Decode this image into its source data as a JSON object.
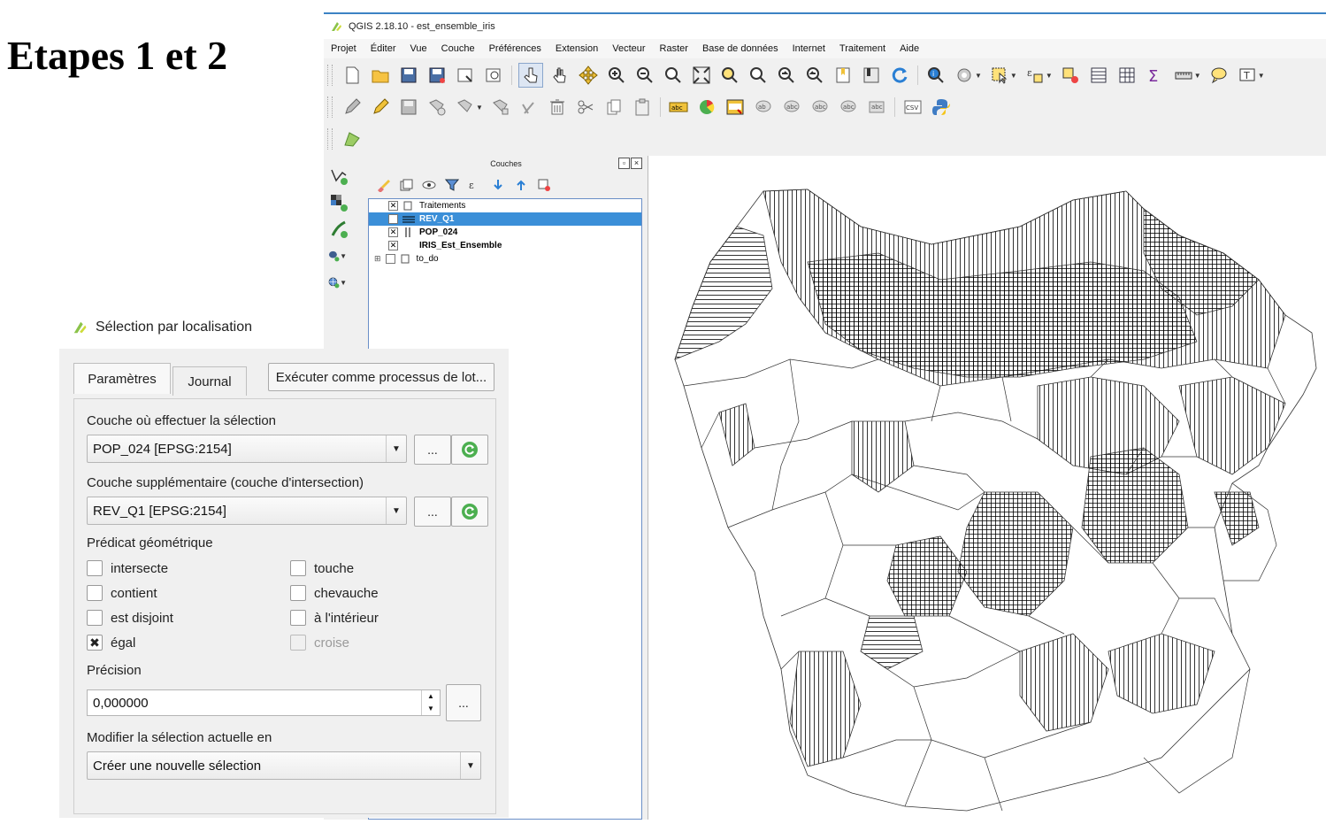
{
  "doc_title": "Etapes 1 et 2",
  "qgis": {
    "window_title": "QGIS 2.18.10 - est_ensemble_iris",
    "menu": [
      "Projet",
      "Éditer",
      "Vue",
      "Couche",
      "Préférences",
      "Extension",
      "Vecteur",
      "Raster",
      "Base de données",
      "Internet",
      "Traitement",
      "Aide"
    ],
    "layers_panel": {
      "title": "Couches",
      "layers": [
        {
          "name": "Traitements",
          "checked": true
        },
        {
          "name": "REV_Q1",
          "checked": true,
          "selected": true
        },
        {
          "name": "POP_024",
          "checked": true
        },
        {
          "name": "IRIS_Est_Ensemble",
          "checked": true
        },
        {
          "name": "to_do",
          "checked": false
        }
      ]
    },
    "toolbar_text": {
      "abc": "abc",
      "csv": "CSV"
    }
  },
  "dialog": {
    "title": "Sélection par localisation",
    "tabs": {
      "params": "Paramètres",
      "journal": "Journal"
    },
    "batch_button": "Exécuter comme processus de lot...",
    "layer_label": "Couche où effectuer la sélection",
    "layer_value": "POP_024 [EPSG:2154]",
    "intersect_label": "Couche supplémentaire (couche d'intersection)",
    "intersect_value": "REV_Q1 [EPSG:2154]",
    "ellipsis": "...",
    "predicate_label": "Prédicat géométrique",
    "predicates": {
      "intersecte": "intersecte",
      "touche": "touche",
      "contient": "contient",
      "chevauche": "chevauche",
      "disjoint": "est disjoint",
      "interieur": "à l'intérieur",
      "egal": "égal",
      "croise": "croise"
    },
    "checked_predicate": "égal",
    "precision_label": "Précision",
    "precision_value": "0,000000",
    "modify_label": "Modifier la sélection actuelle en",
    "modify_value": "Créer une nouvelle sélection"
  },
  "colors": {
    "accent": "#3b8fd8",
    "green": "#4caf50"
  }
}
